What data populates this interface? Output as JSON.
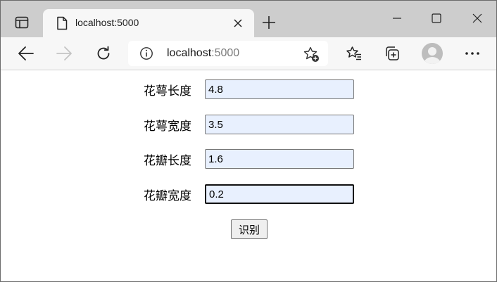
{
  "browser": {
    "tab_title": "localhost:5000",
    "address": {
      "host": "localhost",
      "port": ":5000"
    }
  },
  "form": {
    "fields": [
      {
        "label": "花萼长度",
        "value": "4.8"
      },
      {
        "label": "花萼宽度",
        "value": "3.5"
      },
      {
        "label": "花瓣长度",
        "value": "1.6"
      },
      {
        "label": "花瓣宽度",
        "value": "0.2"
      }
    ],
    "submit_label": "识别"
  },
  "colors": {
    "input_bg": "#e8f0fe",
    "tabstrip": "#cdcdcd",
    "toolbar": "#f7f7f7"
  },
  "icons": [
    "tab-actions-icon",
    "page-icon",
    "close-icon",
    "plus-icon",
    "minimize-icon",
    "maximize-icon",
    "close-window-icon",
    "back-icon",
    "forward-icon",
    "refresh-icon",
    "info-icon",
    "add-favorite-icon",
    "favorites-icon",
    "collections-icon",
    "profile-avatar",
    "more-icon"
  ]
}
